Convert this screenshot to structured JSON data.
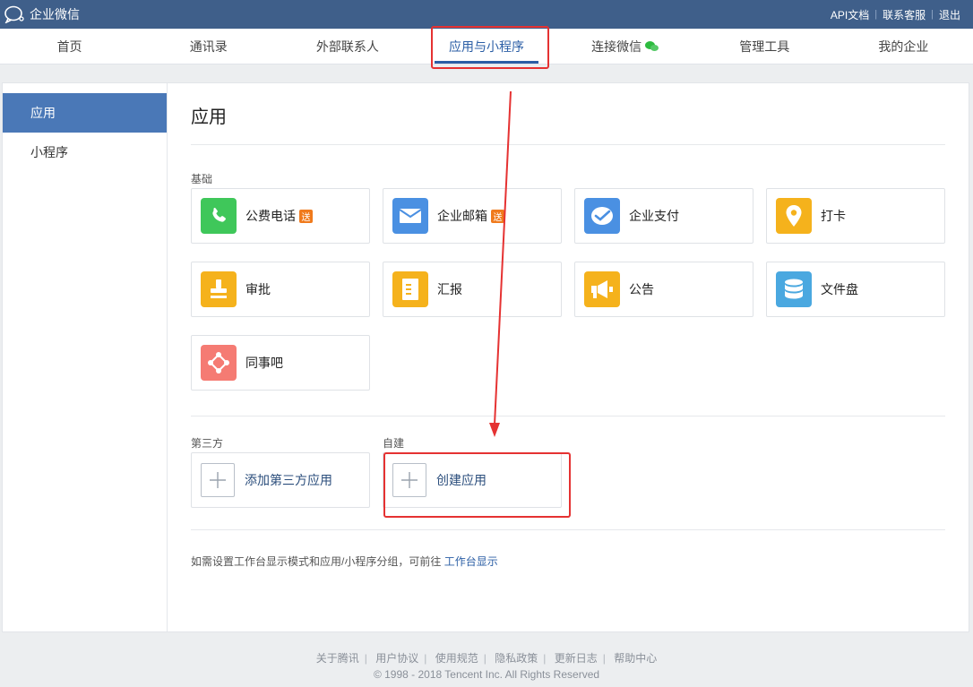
{
  "topbar": {
    "brand": "企业微信",
    "links": [
      "API文档",
      "联系客服",
      "退出"
    ]
  },
  "nav": {
    "items": [
      "首页",
      "通讯录",
      "外部联系人",
      "应用与小程序",
      "连接微信",
      "管理工具",
      "我的企业"
    ],
    "active_index": 3
  },
  "sidebar": {
    "items": [
      "应用",
      "小程序"
    ],
    "active_index": 0
  },
  "main": {
    "title": "应用",
    "basic_label": "基础",
    "basic_apps": [
      {
        "name": "公费电话",
        "badge": "送",
        "icon": "phone-icon",
        "color": "#3fc75a"
      },
      {
        "name": "企业邮箱",
        "badge": "送",
        "icon": "mail-icon",
        "color": "#4a90e2"
      },
      {
        "name": "企业支付",
        "badge": "",
        "icon": "pay-icon",
        "color": "#4a90e2"
      },
      {
        "name": "打卡",
        "badge": "",
        "icon": "location-icon",
        "color": "#f5b21c"
      },
      {
        "name": "审批",
        "badge": "",
        "icon": "stamp-icon",
        "color": "#f5b21c"
      },
      {
        "name": "汇报",
        "badge": "",
        "icon": "report-icon",
        "color": "#f5b21c"
      },
      {
        "name": "公告",
        "badge": "",
        "icon": "megaphone-icon",
        "color": "#f5b21c"
      },
      {
        "name": "文件盘",
        "badge": "",
        "icon": "database-icon",
        "color": "#4aa8e0"
      },
      {
        "name": "同事吧",
        "badge": "",
        "icon": "network-icon",
        "color": "#f57b73"
      }
    ],
    "third_party_label": "第三方",
    "third_party_add": "添加第三方应用",
    "custom_label": "自建",
    "custom_create": "创建应用",
    "hint_text": "如需设置工作台显示模式和应用/小程序分组，可前往",
    "hint_link": "工作台显示"
  },
  "footer": {
    "links": [
      "关于腾讯",
      "用户协议",
      "使用规范",
      "隐私政策",
      "更新日志",
      "帮助中心"
    ],
    "copyright": "© 1998 - 2018 Tencent Inc. All Rights Reserved"
  }
}
